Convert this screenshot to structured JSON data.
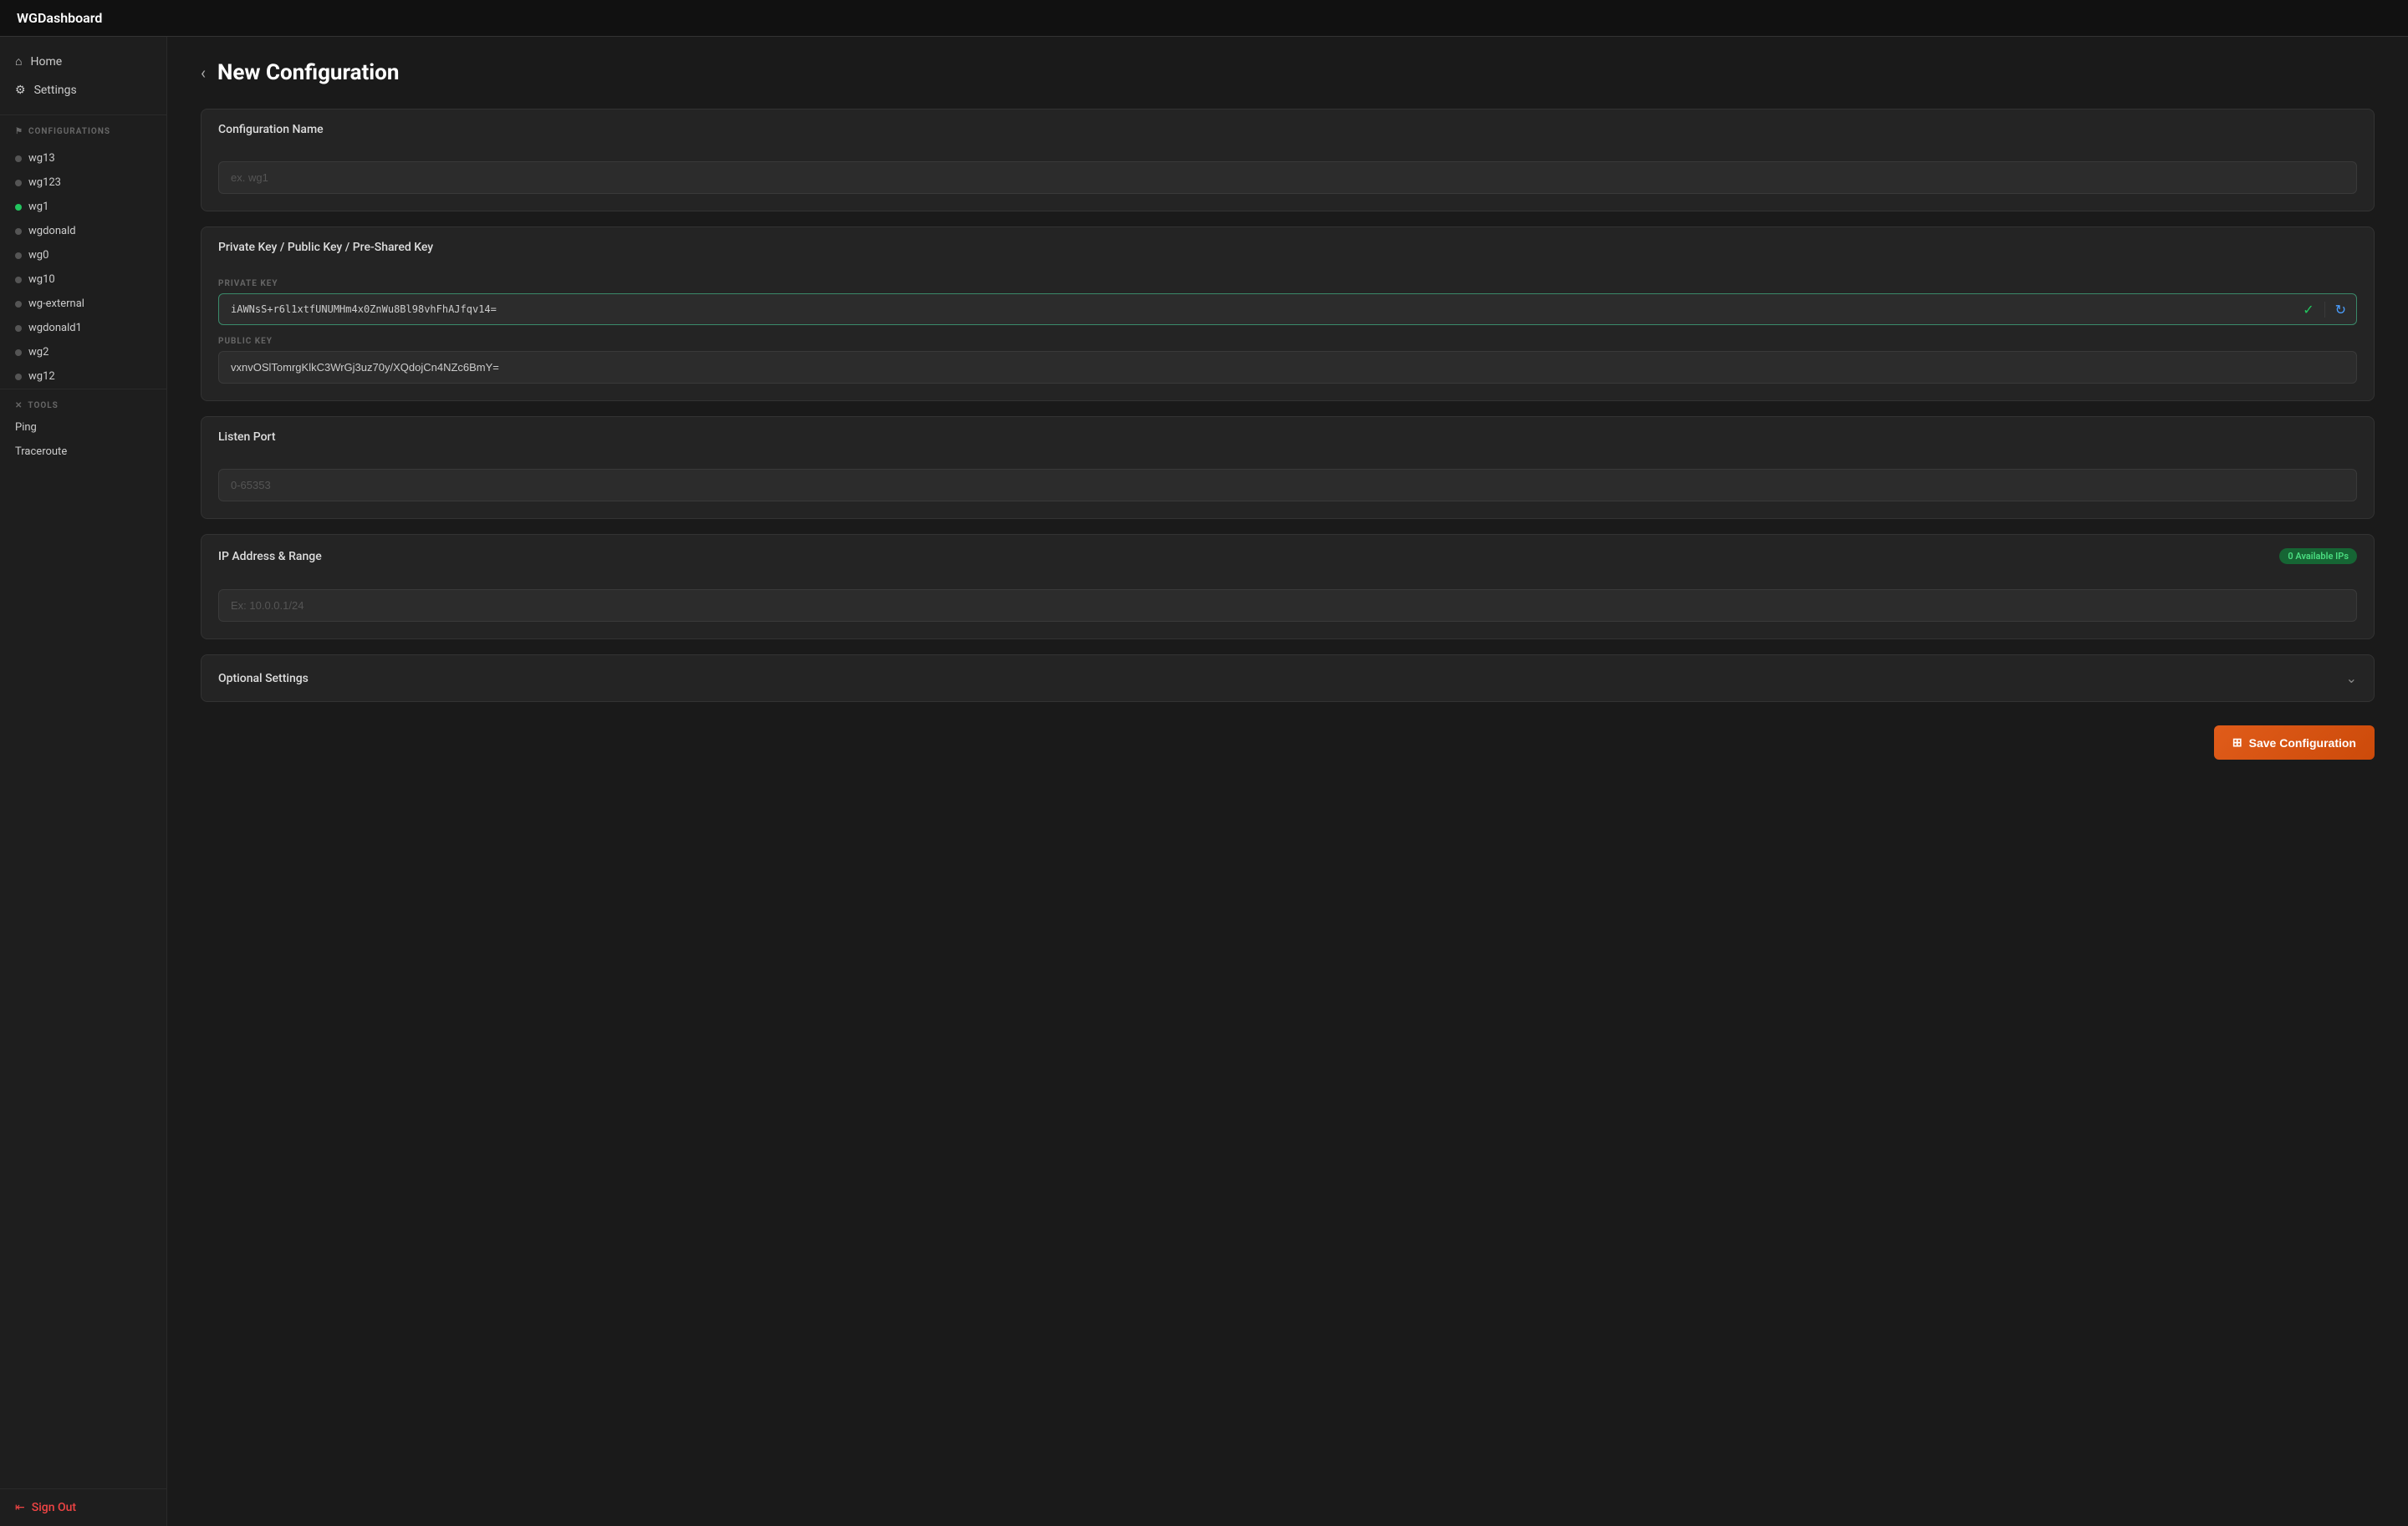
{
  "app": {
    "title": "WGDashboard"
  },
  "sidebar": {
    "nav_items": [
      {
        "id": "home",
        "label": "Home",
        "icon": "⌂"
      },
      {
        "id": "settings",
        "label": "Settings",
        "icon": "⚙"
      }
    ],
    "section_configs_label": "CONFIGURATIONS",
    "section_configs_icon": "⚑",
    "configs": [
      {
        "id": "wg13",
        "label": "wg13",
        "status": "gray"
      },
      {
        "id": "wg123",
        "label": "wg123",
        "status": "gray"
      },
      {
        "id": "wg1",
        "label": "wg1",
        "status": "green"
      },
      {
        "id": "wgdonald",
        "label": "wgdonald",
        "status": "gray"
      },
      {
        "id": "wg0",
        "label": "wg0",
        "status": "gray"
      },
      {
        "id": "wg10",
        "label": "wg10",
        "status": "gray"
      },
      {
        "id": "wg-external",
        "label": "wg-external",
        "status": "gray"
      },
      {
        "id": "wgdonald1",
        "label": "wgdonald1",
        "status": "gray"
      },
      {
        "id": "wg2",
        "label": "wg2",
        "status": "gray"
      },
      {
        "id": "wg12",
        "label": "wg12",
        "status": "gray"
      }
    ],
    "section_tools_label": "TOOLS",
    "section_tools_icon": "✕",
    "tools": [
      {
        "id": "ping",
        "label": "Ping"
      },
      {
        "id": "traceroute",
        "label": "Traceroute"
      }
    ],
    "signout_label": "Sign Out",
    "signout_icon": "⇤"
  },
  "page": {
    "title": "New Configuration",
    "back_label": "‹"
  },
  "form": {
    "config_name_section": "Configuration Name",
    "config_name_placeholder": "ex. wg1",
    "keys_section": "Private Key / Public Key / Pre-Shared Key",
    "private_key_label": "PRIVATE KEY",
    "private_key_value": "iAWNsS+r6l1xtfUNUMHm4x0ZnWu8Bl98vhFhAJfqv14=",
    "public_key_label": "PUBLIC KEY",
    "public_key_value": "vxnvOSlTomrgKlkC3WrGj3uz70y/XQdojCn4NZc6BmY=",
    "listen_port_section": "Listen Port",
    "listen_port_placeholder": "0-65353",
    "ip_section": "IP Address & Range",
    "ip_placeholder": "Ex: 10.0.0.1/24",
    "available_ips_badge": "0 Available IPs",
    "optional_settings_section": "Optional Settings",
    "save_btn_label": "Save Configuration",
    "save_btn_icon": "⊞"
  }
}
